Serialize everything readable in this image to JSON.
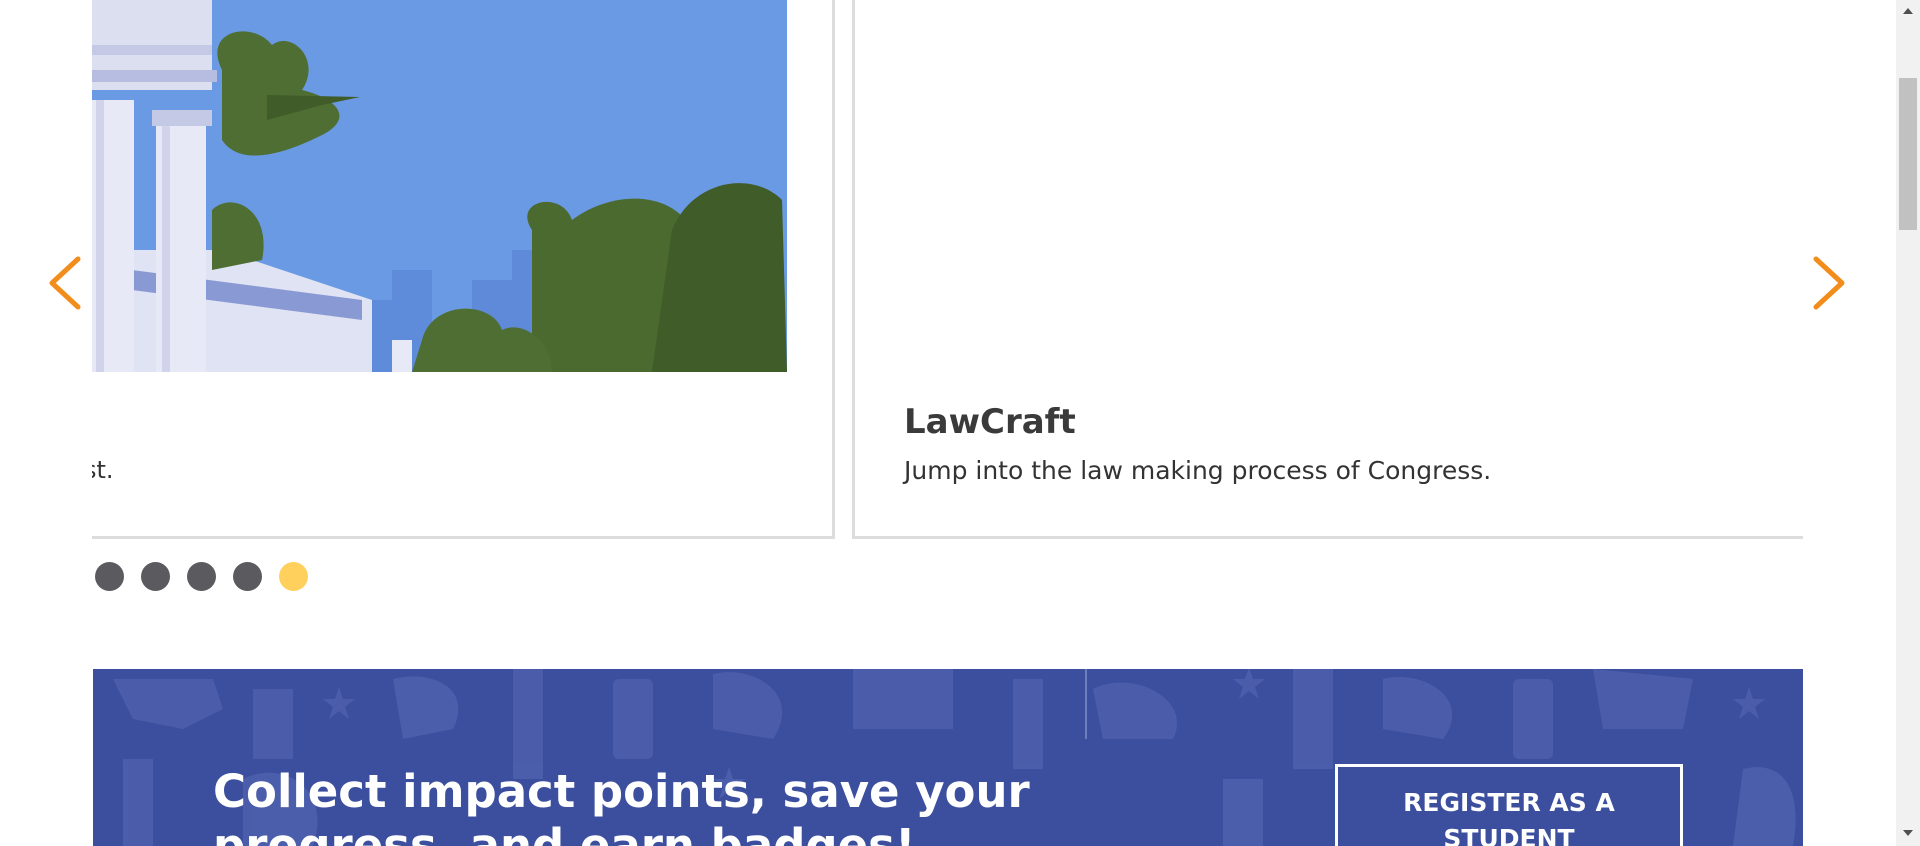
{
  "carousel": {
    "prev_icon": "chevron-left-icon",
    "next_icon": "chevron-right-icon",
    "arrow_color": "#f28c1a",
    "cards": [
      {
        "description_fragment": "st."
      },
      {
        "title": "LawCraft",
        "description": "Jump into the law making process of Congress."
      }
    ],
    "dots": {
      "count": 5,
      "active_index": 4,
      "inactive_color": "#5a5a5f",
      "active_color": "#ffd15c"
    }
  },
  "banner": {
    "headline": "Collect impact points, save your progress, and earn badges!",
    "register_button": "REGISTER AS A STUDENT",
    "background_color": "#3c4f9e"
  },
  "scrollbar": {
    "up_icon": "scroll-up-arrow-icon",
    "down_icon": "scroll-down-arrow-icon"
  }
}
